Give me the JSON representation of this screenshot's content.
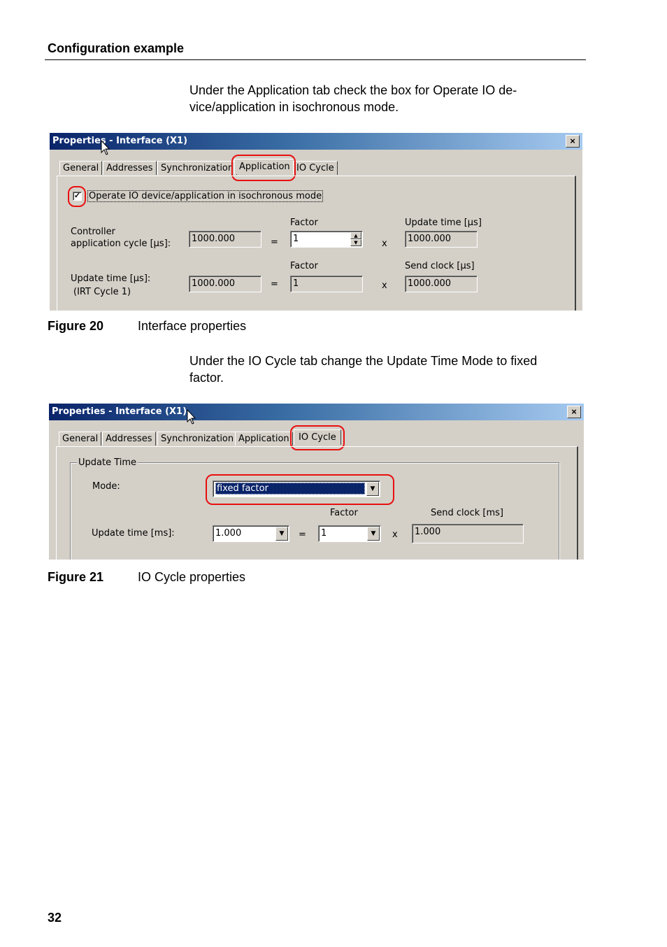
{
  "header": {
    "section_title": "Configuration example"
  },
  "intro1": "Under the Application tab check the box for Operate IO de-vice/application in isochronous mode.",
  "intro1_line1": "Under the Application tab check the box for Operate IO de-",
  "intro1_line2": "vice/application in isochronous mode.",
  "figure20": {
    "title": "Properties - Interface (X1)",
    "close": "×",
    "tabs": [
      "General",
      "Addresses",
      "Synchronization",
      "Application",
      "IO Cycle"
    ],
    "active_tab": "Application",
    "checkbox_label": "Operate IO device/application in isochronous mode",
    "checkbox_checked": true,
    "row1": {
      "label_line1": "Controller",
      "label_line2": "application cycle [µs]:",
      "value": "1000.000",
      "eq": "=",
      "factor_label": "Factor",
      "factor": "1",
      "x": "x",
      "result_label": "Update time [µs]",
      "result": "1000.000"
    },
    "row2": {
      "label_line1": "Update time [µs]:",
      "label_line2": "(IRT Cycle 1)",
      "value": "1000.000",
      "eq": "=",
      "factor_label": "Factor",
      "factor": "1",
      "x": "x",
      "result_label": "Send clock [µs]",
      "result": "1000.000"
    },
    "caption_num": "Figure 20",
    "caption": "Interface properties"
  },
  "intro2_line1": "Under the IO Cycle tab change the Update Time Mode to fixed",
  "intro2_line2": "factor.",
  "figure21": {
    "title": "Properties - Interface (X1)",
    "close": "×",
    "tabs": [
      "General",
      "Addresses",
      "Synchronization",
      "Application",
      "IO Cycle"
    ],
    "active_tab": "IO Cycle",
    "group_label": "Update Time",
    "mode_label": "Mode:",
    "mode_value": "fixed factor",
    "factor_label": "Factor",
    "send_clock_label": "Send clock [ms]",
    "update_label": "Update time [ms]:",
    "update_value": "1.000",
    "eq": "=",
    "factor_value": "1",
    "x": "x",
    "send_clock_value": "1.000",
    "caption_num": "Figure 21",
    "caption": "IO Cycle properties"
  },
  "footer": {
    "page_number": "32"
  },
  "colors": {
    "highlight_red": "#e81010",
    "titlebar": "#0a246a",
    "dialog_bg": "#d4d0c8"
  }
}
